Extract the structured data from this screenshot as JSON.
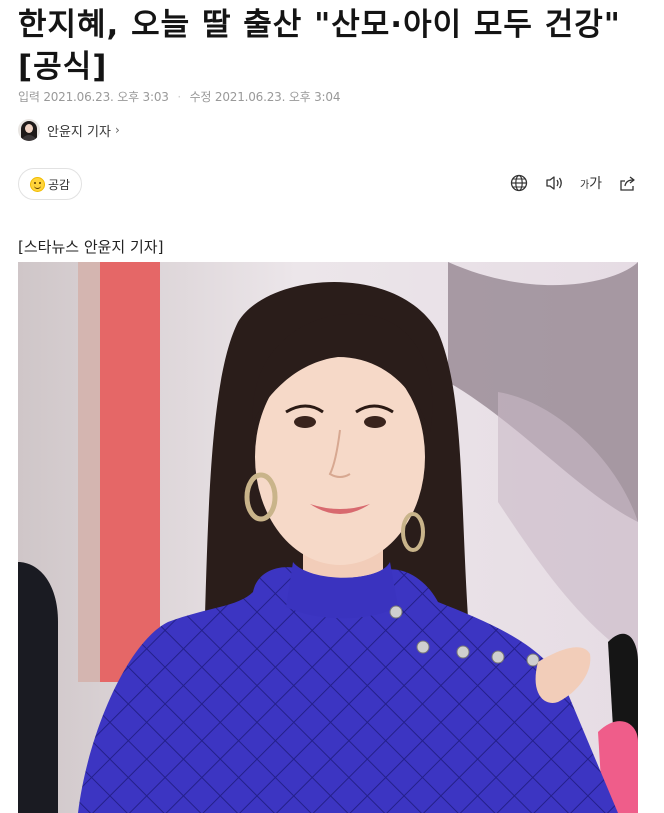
{
  "article": {
    "title": "한지혜, 오늘 딸 출산 \"산모·아이 모두 건강\"[공식]",
    "input_label": "입력",
    "input_time": "2021.06.23. 오후 3:03",
    "modified_label": "수정",
    "modified_time": "2021.06.23. 오후 3:04",
    "reporter": "안윤지 기자",
    "caption": "[스타뉴스 안윤지 기자]"
  },
  "toolbar": {
    "empathy_label": "공감",
    "fontsize_small": "가",
    "fontsize_large": "가",
    "icons": [
      "globe-icon",
      "speaker-icon",
      "font-size-icon",
      "share-icon"
    ]
  },
  "colors": {
    "sweater": "#3d37c4",
    "background_pink": "#e8dde2",
    "curtain_red": "#e65a5a"
  }
}
